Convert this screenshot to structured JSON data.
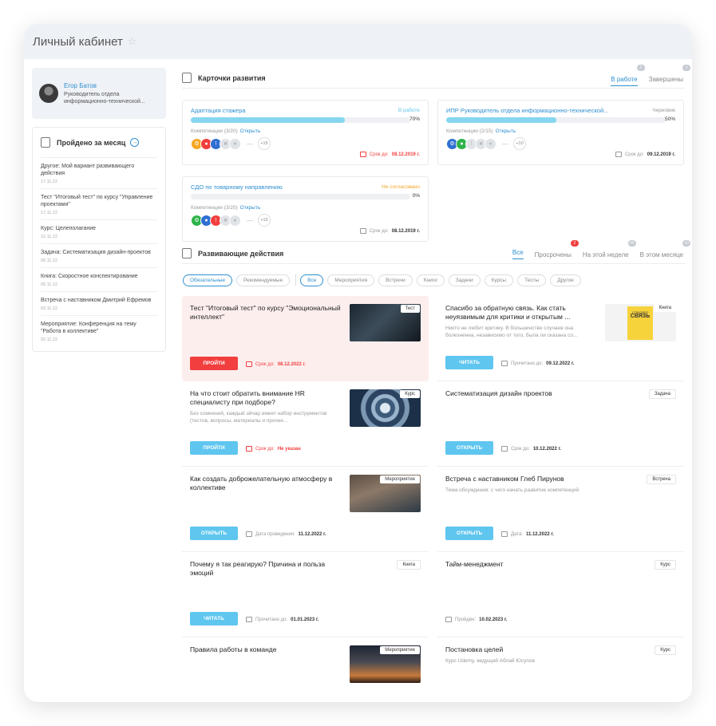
{
  "header": {
    "title": "Личный кабинет"
  },
  "profile": {
    "name": "Егор Батов",
    "role_line1": "Руководитель отдела",
    "role_line2": "информационно-технической..."
  },
  "completed": {
    "title": "Пройдено за месяц",
    "items": [
      {
        "title": "Другое: Мой вариант развивающего действия",
        "date": "17.11.22"
      },
      {
        "title": "Тест \"Итоговый тест\" по курсу \"Управление проектами\"",
        "date": "17.11.22"
      },
      {
        "title": "Курс: Целеполагание",
        "date": "12.11.22"
      },
      {
        "title": "Задача: Систематизация дизайн-проектов",
        "date": "06.11.22"
      },
      {
        "title": "Книга: Скоростное конспектирование",
        "date": "05.11.22"
      },
      {
        "title": "Встреча с наставником Дмитрий Ефремов",
        "date": "03.11.22"
      },
      {
        "title": "Мероприятие: Конференция на тему \"Работа в коллективе\"",
        "date": "02.11.22"
      }
    ]
  },
  "dev_cards": {
    "title": "Карточки развития",
    "tabs": [
      {
        "label": "В работе",
        "count": "3"
      },
      {
        "label": "Завершены",
        "count": "1"
      }
    ],
    "cards": [
      {
        "title": "Адаптация стажера",
        "status": "В работе",
        "status_color": "#5fc6ef",
        "progress": 70,
        "progress_label": "70%",
        "competencies": "Компетенции (3/20)",
        "open": "Открыть",
        "more": "+15",
        "due_label": "Срок до:",
        "due": "08.12.2019 г.",
        "overdue": true,
        "icons": [
          "#f5a623",
          "#f23e3e",
          "#2f6fd1",
          "#e0e3e8",
          "#e0e3e8"
        ]
      },
      {
        "title": "ИПР Руководитель отдела информационно-технической...",
        "status": "Черновик",
        "status_color": "#999999",
        "progress": 50,
        "progress_label": "50%",
        "competencies": "Компетенции (2/15)",
        "open": "Открыть",
        "more": "+10",
        "due_label": "Срок до:",
        "due": "09.12.2019 г.",
        "overdue": false,
        "icons": [
          "#2f6fd1",
          "#2eb34a",
          "#e0e3e8",
          "#e0e3e8",
          "#e0e3e8"
        ]
      },
      {
        "title": "СДО по товарному направлению",
        "status": "Не согласовано",
        "status_color": "#f5a623",
        "progress": 0,
        "progress_label": "0%",
        "competencies": "Компетенции (3/20)",
        "open": "Открыть",
        "more": "+15",
        "due_label": "Срок до:",
        "due": "08.12.2019 г.",
        "overdue": false,
        "icons": [
          "#2eb34a",
          "#2f6fd1",
          "#f23e3e",
          "#e0e3e8",
          "#e0e3e8"
        ]
      }
    ]
  },
  "actions": {
    "title": "Развивающие действия",
    "tabs": [
      {
        "label": "Все",
        "count": ""
      },
      {
        "label": "Просрочены",
        "count": "2"
      },
      {
        "label": "На этой неделе",
        "count": "10"
      },
      {
        "label": "В этом месяце",
        "count": "10"
      }
    ],
    "filter_a": [
      "Обязательные",
      "Рекомендуемые"
    ],
    "filter_b": [
      "Все",
      "Мероприятия",
      "Встречи",
      "Книги",
      "Задачи",
      "Курсы",
      "Тесты",
      "Другое"
    ],
    "items": [
      {
        "title": "Тест \"Итоговый тест\" по курсу \"Эмоциональный интеллект\"",
        "desc": "",
        "type": "Тест",
        "thumb": "dark",
        "button": "ПРОЙТИ",
        "btn_color": "red",
        "meta_label": "Срок до:",
        "meta_value": "08.12.2022 г.",
        "red": true,
        "hl": true
      },
      {
        "title": "Спасибо за обратную связь. Как стать неуязвимым для критики и открытым ...",
        "desc": "Никто не любит критику. В большинстве случаев она болезненна, независимо от того, была ли сказана со...",
        "type": "Книга",
        "thumb": "book",
        "button": "ЧИТАТЬ",
        "btn_color": "blue",
        "meta_label": "Прочитано до:",
        "meta_value": "09.12.2022 г.",
        "red": false,
        "hl": false
      },
      {
        "title": "На что стоит обратить внимание HR специалисту при подборе?",
        "desc": "Без сомнений, каждый эйчар имеет набор инструментов (тестов, вопросы, материалы и прочее...",
        "type": "Курс",
        "thumb": "tunnel",
        "button": "ПРОЙТИ",
        "btn_color": "blue",
        "meta_label": "Срок до:",
        "meta_value": "Не указан",
        "red": true,
        "hl": false
      },
      {
        "title": "Систематизация дизайн проектов",
        "desc": "",
        "type": "Задача",
        "thumb": "",
        "button": "ОТКРЫТЬ",
        "btn_color": "blue",
        "meta_label": "Срок до:",
        "meta_value": "10.12.2022 г.",
        "red": false,
        "hl": false
      },
      {
        "title": "Как создать доброжелательную атмосферу в коллективе",
        "desc": "",
        "type": "Мероприятие",
        "thumb": "people",
        "button": "ОТКРЫТЬ",
        "btn_color": "blue",
        "meta_label": "Дата проведения:",
        "meta_value": "11.12.2022 г.",
        "red": false,
        "hl": false
      },
      {
        "title": "Встреча с наставником Глеб Пирунов",
        "desc": "Тема обсуждения: с чего начать развитие компетенций",
        "type": "Встреча",
        "thumb": "",
        "button": "ОТКРЫТЬ",
        "btn_color": "blue",
        "meta_label": "Дата:",
        "meta_value": "11.12.2022 г.",
        "red": false,
        "hl": false
      },
      {
        "title": "Почему я так реагирую? Причина и польза эмоций",
        "desc": "",
        "type": "Книга",
        "thumb": "",
        "button": "ЧИТАТЬ",
        "btn_color": "blue",
        "meta_label": "Прочитано до:",
        "meta_value": "01.01.2023 г.",
        "red": false,
        "hl": false
      },
      {
        "title": "Тайм-менеджмент",
        "desc": "",
        "type": "Курс",
        "thumb": "",
        "button": "",
        "btn_color": "",
        "meta_label": "Пройден:",
        "meta_value": "10.02.2023 г.",
        "red": false,
        "hl": false
      },
      {
        "title": "Правила работы в команде",
        "desc": "",
        "type": "Мероприятие",
        "thumb": "sunset",
        "button": "",
        "btn_color": "",
        "meta_label": "",
        "meta_value": "",
        "red": false,
        "hl": false
      },
      {
        "title": "Постановка целей",
        "desc": "Курс Udemy, ведущий Аблай Юсупов",
        "type": "Курс",
        "thumb": "",
        "button": "",
        "btn_color": "",
        "meta_label": "",
        "meta_value": "",
        "red": false,
        "hl": false
      }
    ]
  },
  "book_cover_text": {
    "top": "СПАСИБО",
    "big": "СВЯЗЬ"
  }
}
